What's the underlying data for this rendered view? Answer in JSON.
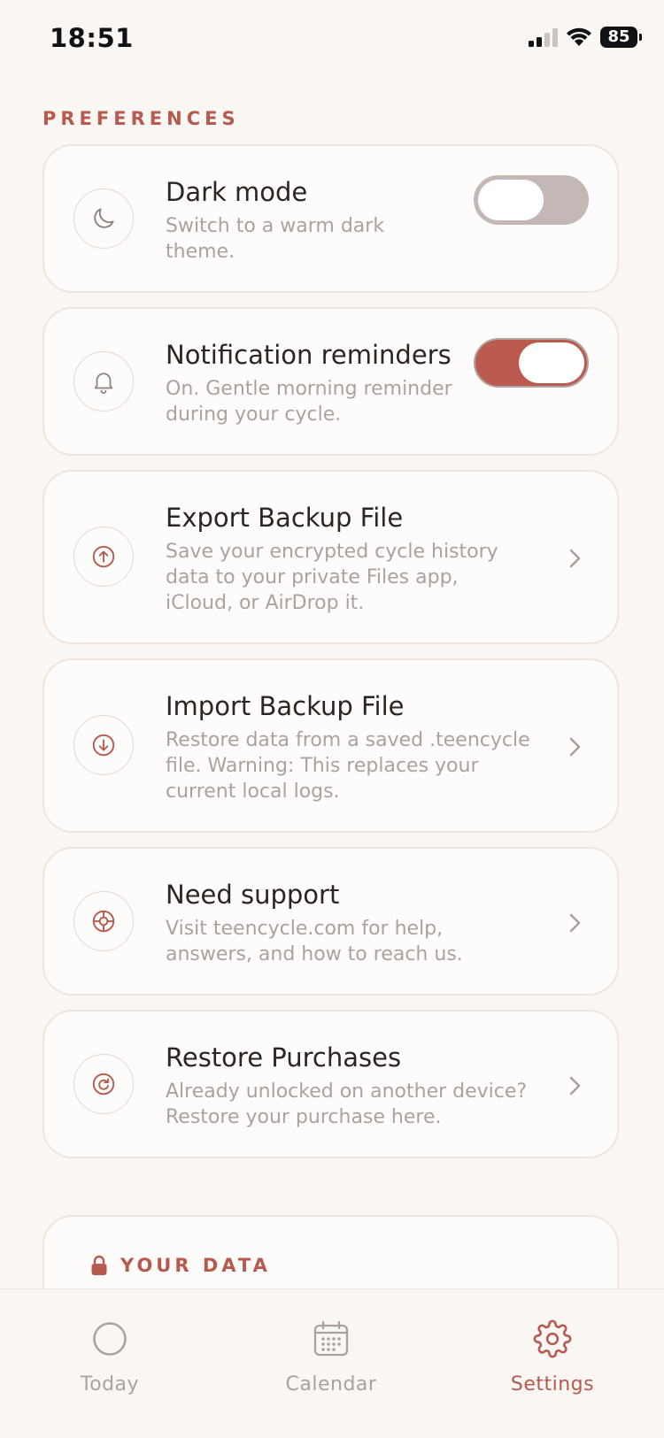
{
  "status_bar": {
    "time": "18:51",
    "battery": "85"
  },
  "preferences": {
    "section_title": "PREFERENCES",
    "items": [
      {
        "title": "Dark mode",
        "description": "Switch to a warm dark theme.",
        "icon": "moon-icon",
        "control": "toggle",
        "toggle_on": false
      },
      {
        "title": "Notification reminders",
        "description": "On. Gentle morning reminder during your cycle.",
        "icon": "bell-icon",
        "control": "toggle",
        "toggle_on": true
      },
      {
        "title": "Export Backup File",
        "description": "Save your encrypted cycle history data to your private Files app, iCloud, or AirDrop it.",
        "icon": "upload-icon",
        "control": "chevron"
      },
      {
        "title": "Import Backup File",
        "description": "Restore data from a saved .teencycle file. Warning: This replaces your current local logs.",
        "icon": "download-icon",
        "control": "chevron"
      },
      {
        "title": "Need support",
        "description": "Visit teencycle.com for help, answers, and how to reach us.",
        "icon": "lifebuoy-icon",
        "control": "chevron"
      },
      {
        "title": "Restore Purchases",
        "description": "Already unlocked on another device? Restore your purchase here.",
        "icon": "restore-icon",
        "control": "chevron"
      }
    ]
  },
  "data_section": {
    "title": "YOUR DATA",
    "icon": "lock-icon"
  },
  "tab_bar": {
    "tabs": [
      {
        "label": "Today",
        "icon": "circle-icon",
        "active": false
      },
      {
        "label": "Calendar",
        "icon": "calendar-icon",
        "active": false
      },
      {
        "label": "Settings",
        "icon": "gear-icon",
        "active": true
      }
    ]
  },
  "colors": {
    "accent": "#b65a4e",
    "background": "#f9f6f3",
    "card": "#fefcfa",
    "muted_text": "#aba2a0"
  }
}
